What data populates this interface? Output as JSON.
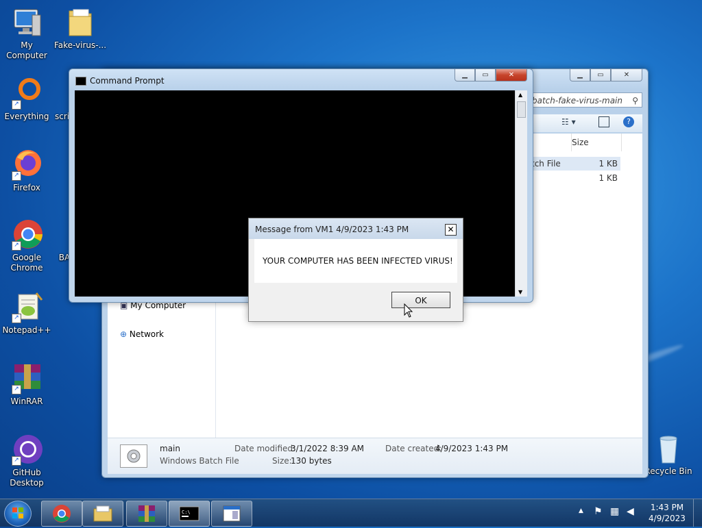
{
  "desktop": {
    "icons": [
      {
        "label": "My Computer",
        "icon": "my-computer-icon"
      },
      {
        "label": "Fake-virus-...",
        "icon": "folder-icon"
      },
      {
        "label": "Everything",
        "icon": "everything-icon"
      },
      {
        "label": "scri",
        "icon": "script-file-icon"
      },
      {
        "label": "Firefox",
        "icon": "firefox-icon"
      },
      {
        "label": "Google Chrome",
        "icon": "chrome-icon"
      },
      {
        "label": "BA",
        "icon": "batch-file-icon"
      },
      {
        "label": "Notepad++",
        "icon": "notepadpp-icon"
      },
      {
        "label": "WinRAR",
        "icon": "winrar-icon"
      },
      {
        "label": "GitHub Desktop",
        "icon": "github-icon"
      },
      {
        "label": "Recycle Bin",
        "icon": "recycle-bin-icon"
      }
    ]
  },
  "explorer": {
    "address": "batch-fake-virus-main",
    "column_size": "Size",
    "rows": [
      {
        "type": "tch File",
        "size": "1 KB"
      },
      {
        "type": "",
        "size": "1 KB"
      }
    ],
    "nav": [
      "My Computer",
      "Network"
    ],
    "details": {
      "name": "main",
      "type": "Windows Batch File",
      "date_modified_label": "Date modified:",
      "date_modified": "3/1/2022 8:39 AM",
      "date_created_label": "Date created:",
      "date_created": "4/9/2023 1:43 PM",
      "size_label": "Size:",
      "size": "130 bytes"
    }
  },
  "cmd": {
    "title": "Command Prompt"
  },
  "dialog": {
    "title": "Message from VM1 4/9/2023 1:43 PM",
    "message": "YOUR COMPUTER HAS BEEN INFECTED VIRUS!",
    "ok_label": "OK"
  },
  "taskbar": {
    "time": "1:43 PM",
    "date": "4/9/2023"
  },
  "colors": {
    "desktop": "#1c73c9",
    "console": "#000000",
    "close_button": "#c7452c"
  }
}
